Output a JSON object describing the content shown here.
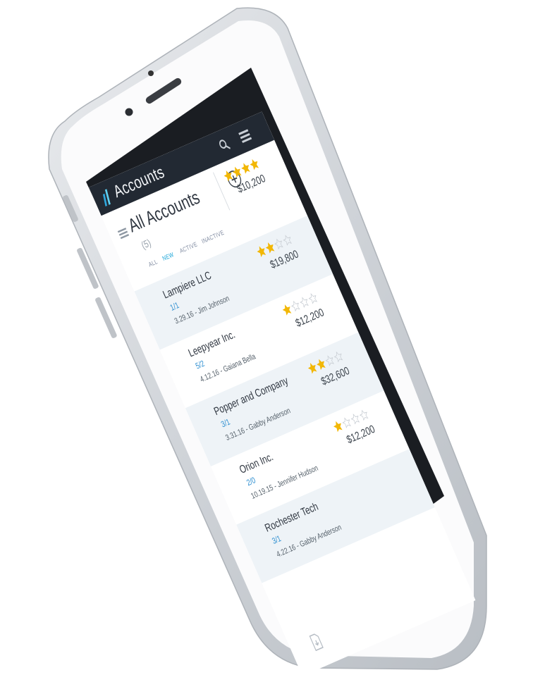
{
  "app": {
    "title": "Accounts"
  },
  "section": {
    "title": "All Accounts",
    "count": "(5)",
    "summary_amount": "$10,200",
    "summary_stars": 4
  },
  "filters": [
    {
      "label": "ALL",
      "selected": false
    },
    {
      "label": "NEW",
      "selected": true
    },
    {
      "label": "ACTIVE",
      "selected": false
    },
    {
      "label": "INACTIVE",
      "selected": false
    }
  ],
  "accounts": [
    {
      "name": "Lampiere LLC",
      "ratio": "1/1",
      "meta": "3.29.16 - Jim Johnson",
      "amount": "$19,800",
      "stars": 2
    },
    {
      "name": "Leepyear Inc.",
      "ratio": "5/2",
      "meta": "4.12.16 - Gaiana Bella",
      "amount": "$12,200",
      "stars": 1
    },
    {
      "name": "Popper and Company",
      "ratio": "3/1",
      "meta": "3.31.16 - Gabby Anderson",
      "amount": "$32,600",
      "stars": 2
    },
    {
      "name": "Orion Inc.",
      "ratio": "2/0",
      "meta": "10.19.15 - Jennifer Hudson",
      "amount": "$12,200",
      "stars": 1
    },
    {
      "name": "Rochester Tech",
      "ratio": "3/1",
      "meta": "4.22.16 - Gabby Anderson",
      "amount": "",
      "stars": 0
    }
  ],
  "icons": {
    "search": "search-icon",
    "menu": "hamburger-menu-icon",
    "add": "add-circle-icon",
    "list": "list-menu-icon",
    "logo": "app-logo-icon",
    "bottom": "document-icon"
  },
  "colors": {
    "appbar": "#222933",
    "accent": "#18a4d8",
    "star_filled": "#f2b705",
    "row_alt": "#eef3f7"
  }
}
